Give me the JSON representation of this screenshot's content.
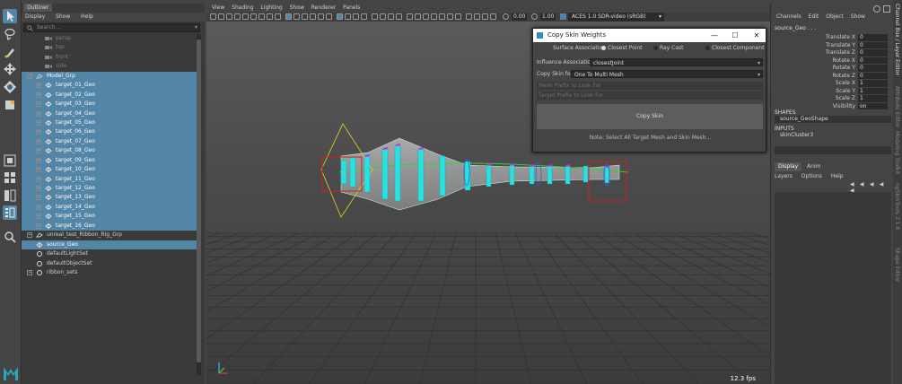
{
  "outliner": {
    "tab": "Outliner",
    "menu": [
      "Display",
      "Show",
      "Help"
    ],
    "search_placeholder": "Search...",
    "rows": [
      {
        "label": "persp",
        "indent": 2,
        "icon": "camera",
        "dim": true,
        "sel": false
      },
      {
        "label": "top",
        "indent": 2,
        "icon": "camera",
        "dim": true,
        "sel": false
      },
      {
        "label": "front",
        "indent": 2,
        "icon": "camera",
        "dim": true,
        "sel": false
      },
      {
        "label": "side",
        "indent": 2,
        "icon": "camera",
        "dim": true,
        "sel": false
      },
      {
        "label": "Model_Grp",
        "indent": 1,
        "icon": "group",
        "dim": false,
        "sel": true,
        "exp": "minus"
      },
      {
        "label": "target_01_Geo",
        "indent": 2,
        "icon": "mesh",
        "dim": false,
        "sel": true,
        "exp": "plus"
      },
      {
        "label": "target_02_Geo",
        "indent": 2,
        "icon": "mesh",
        "dim": false,
        "sel": true,
        "exp": "plus"
      },
      {
        "label": "target_03_Geo",
        "indent": 2,
        "icon": "mesh",
        "dim": false,
        "sel": true,
        "exp": "plus"
      },
      {
        "label": "target_04_Geo",
        "indent": 2,
        "icon": "mesh",
        "dim": false,
        "sel": true,
        "exp": "plus"
      },
      {
        "label": "target_05_Geo",
        "indent": 2,
        "icon": "mesh",
        "dim": false,
        "sel": true,
        "exp": "plus"
      },
      {
        "label": "target_06_Geo",
        "indent": 2,
        "icon": "mesh",
        "dim": false,
        "sel": true,
        "exp": "plus"
      },
      {
        "label": "target_07_Geo",
        "indent": 2,
        "icon": "mesh",
        "dim": false,
        "sel": true,
        "exp": "plus"
      },
      {
        "label": "target_08_Geo",
        "indent": 2,
        "icon": "mesh",
        "dim": false,
        "sel": true,
        "exp": "plus"
      },
      {
        "label": "target_09_Geo",
        "indent": 2,
        "icon": "mesh",
        "dim": false,
        "sel": true,
        "exp": "plus"
      },
      {
        "label": "target_10_Geo",
        "indent": 2,
        "icon": "mesh",
        "dim": false,
        "sel": true,
        "exp": "plus"
      },
      {
        "label": "target_11_Geo",
        "indent": 2,
        "icon": "mesh",
        "dim": false,
        "sel": true,
        "exp": "plus"
      },
      {
        "label": "target_12_Geo",
        "indent": 2,
        "icon": "mesh",
        "dim": false,
        "sel": true,
        "exp": "plus"
      },
      {
        "label": "target_13_Geo",
        "indent": 2,
        "icon": "mesh",
        "dim": false,
        "sel": true,
        "exp": "plus"
      },
      {
        "label": "target_14_Geo",
        "indent": 2,
        "icon": "mesh",
        "dim": false,
        "sel": true,
        "exp": "plus"
      },
      {
        "label": "target_15_Geo",
        "indent": 2,
        "icon": "mesh",
        "dim": false,
        "sel": true,
        "exp": "plus"
      },
      {
        "label": "target_16_Geo",
        "indent": 2,
        "icon": "mesh",
        "dim": false,
        "sel": true,
        "exp": "plus"
      },
      {
        "label": "unreal_test_Ribbon_Rig_Grp",
        "indent": 1,
        "icon": "group",
        "dim": false,
        "sel": false,
        "exp": "plus"
      },
      {
        "label": "source_Geo",
        "indent": 1,
        "icon": "mesh",
        "dim": false,
        "sel": true
      },
      {
        "label": "defaultLightSet",
        "indent": 1,
        "icon": "set",
        "dim": false,
        "sel": false
      },
      {
        "label": "defaultObjectSet",
        "indent": 1,
        "icon": "set",
        "dim": false,
        "sel": false
      },
      {
        "label": "ribbon_sets",
        "indent": 1,
        "icon": "set",
        "dim": false,
        "sel": false,
        "exp": "plus"
      }
    ]
  },
  "viewport": {
    "menu": [
      "View",
      "Shading",
      "Lighting",
      "Show",
      "Renderer",
      "Panels"
    ],
    "exposure": "0.00",
    "gamma": "1.00",
    "colorspace": "ACES 1.0 SDR-video (sRGB)",
    "fps": "12.3 fps"
  },
  "dialog": {
    "title": "Copy Skin Weights",
    "surface_label": "Surface Association",
    "surface_options": [
      "Closest Point",
      "Ray Cast",
      "Closest Component"
    ],
    "surface_selected": 0,
    "influence_label": "Influence Association",
    "influence_value": "closestJoint",
    "copy_for_label": "Copy Skin for",
    "copy_for_value": "One To Multi Mesh",
    "mesh_prefix_placeholder": "Mesh Prefix to Look For",
    "target_prefix_placeholder": "Target Prefix to Look For",
    "button": "Copy Skin",
    "note": "Note: Select All Target Mesh and Skin Mesh..."
  },
  "channel_box": {
    "menu": [
      "Channels",
      "Edit",
      "Object",
      "Show"
    ],
    "object": "source_Geo . . .",
    "attributes": [
      {
        "name": "Translate X",
        "value": "0"
      },
      {
        "name": "Translate Y",
        "value": "0"
      },
      {
        "name": "Translate Z",
        "value": "0"
      },
      {
        "name": "Rotate X",
        "value": "0"
      },
      {
        "name": "Rotate Y",
        "value": "0"
      },
      {
        "name": "Rotate Z",
        "value": "0"
      },
      {
        "name": "Scale X",
        "value": "1"
      },
      {
        "name": "Scale Y",
        "value": "1"
      },
      {
        "name": "Scale Z",
        "value": "1"
      },
      {
        "name": "Visibility",
        "value": "on"
      }
    ],
    "shapes_head": "SHAPES",
    "shape_item": "source_GeoShape",
    "inputs_head": "INPUTS",
    "input_item": "skinCluster3",
    "layer_tabs": [
      "Display",
      "Anim"
    ],
    "layer_menu": [
      "Layers",
      "Options",
      "Help"
    ]
  },
  "side_tabs": [
    "Channel Box / Layer Editor",
    "Attribute Editor",
    "Modeling Toolkit",
    "ngSkinTools 2.1.6",
    "Shape Editor"
  ]
}
